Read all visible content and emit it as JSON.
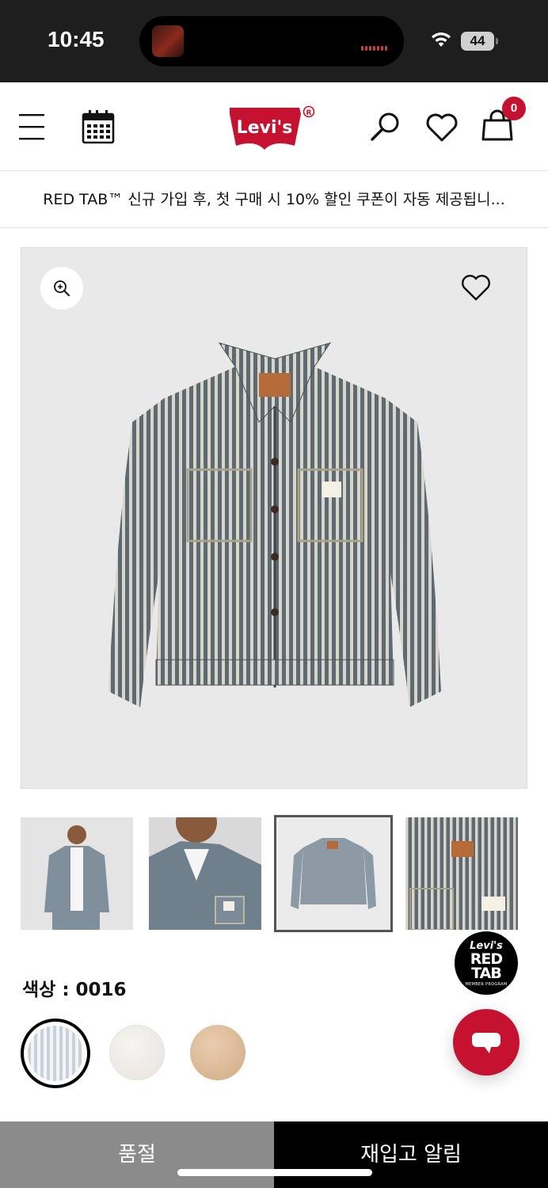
{
  "status_bar": {
    "time": "10:45",
    "battery": "44",
    "icons": [
      "wifi-icon",
      "battery-icon"
    ]
  },
  "header": {
    "logo_text": "Levi's",
    "cart_count": "0",
    "icons": [
      "menu-icon",
      "calendar-icon",
      "search-icon",
      "heart-icon",
      "shopping-bag-icon"
    ],
    "brand_color": "#c41230"
  },
  "promo": {
    "text": "RED TAB™ 신규 가입 후, 첫 구매 시 10% 할인 쿠폰이 자동 제공됩니..."
  },
  "gallery": {
    "icons": [
      "zoom-in-icon",
      "heart-icon"
    ],
    "thumbnails": [
      "model-front",
      "model-closeup",
      "product-flat",
      "product-detail"
    ],
    "selected_index": 2
  },
  "color": {
    "label": "색상 : 0016",
    "swatches": [
      {
        "name": "hickory-stripe",
        "color": "#c8d2dc",
        "selected": true
      },
      {
        "name": "cream",
        "color": "#efece7",
        "selected": false
      },
      {
        "name": "tan",
        "color": "#ddb991",
        "selected": false
      }
    ]
  },
  "red_tab_badge": {
    "line1": "Levi's",
    "line2": "RED",
    "line3": "TAB",
    "line4": "MEMBER PROGRAM"
  },
  "actions": {
    "soldout": "품절",
    "restock": "재입고 알림",
    "icons": [
      "chat-icon"
    ]
  }
}
